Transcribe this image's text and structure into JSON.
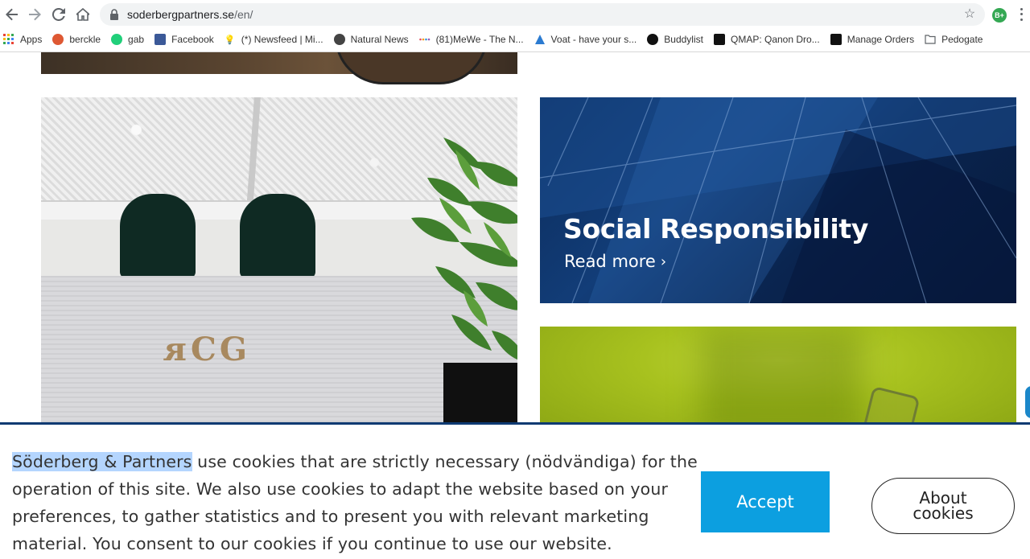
{
  "browser": {
    "url_host": "soderbergpartners.se",
    "url_path": "/en/",
    "extension_badge": "B+",
    "bookmarks": [
      {
        "label": "Apps",
        "icon": "apps-grid-icon",
        "color": "#e94235"
      },
      {
        "label": "berckle",
        "icon": "duckduckgo-icon",
        "color": "#de5833"
      },
      {
        "label": "gab",
        "icon": "gab-icon",
        "color": "#21cf7a"
      },
      {
        "label": "Facebook",
        "icon": "facebook-icon",
        "color": "#3b5998"
      },
      {
        "label": "(*) Newsfeed | Mi...",
        "icon": "lightbulb-icon",
        "color": "#f5c518"
      },
      {
        "label": "Natural News",
        "icon": "naturalnews-icon",
        "color": "#444444"
      },
      {
        "label": "(81)MeWe - The N...",
        "icon": "mewe-icon",
        "color": "#e34b5e"
      },
      {
        "label": "Voat - have your s...",
        "icon": "voat-icon",
        "color": "#2b7bd1"
      },
      {
        "label": "Buddylist",
        "icon": "buddylist-icon",
        "color": "#111111"
      },
      {
        "label": "QMAP: Qanon Dro...",
        "icon": "qmap-icon",
        "color": "#111111"
      },
      {
        "label": "Manage Orders",
        "icon": "amazon-icon",
        "color": "#111111"
      },
      {
        "label": "Pedogate",
        "icon": "folder-icon",
        "color": "#5f6368"
      }
    ]
  },
  "cards": {
    "social_title": "Social Responsibility",
    "read_more": "Read more",
    "read_more_chevron": "›",
    "office_letters": "ᴙCG"
  },
  "cookie": {
    "brand": "Söderberg & Partners",
    "text": " use cookies that are strictly necessary (nödvändiga) for the operation of this site. We also use cookies to adapt the website based on your preferences, to gather statistics and to present you with relevant marketing material. You consent to our cookies if you continue to use our website.",
    "accept_label": "Accept",
    "about_label": "About\ncookies"
  },
  "colors": {
    "accept_bg": "#0c9fe0",
    "banner_border": "#0e3a72",
    "selection_highlight": "#b4d5fe"
  }
}
